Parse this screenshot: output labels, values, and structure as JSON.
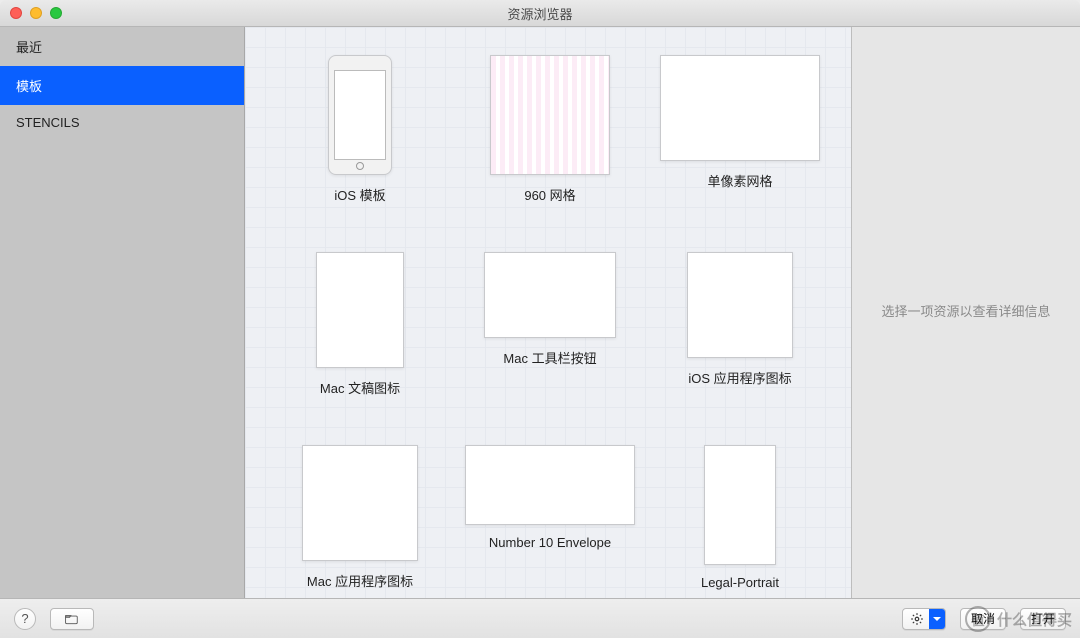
{
  "window": {
    "title": "资源浏览器"
  },
  "sidebar": {
    "items": [
      {
        "label": "最近",
        "selected": false
      },
      {
        "label": "模板",
        "selected": true
      },
      {
        "label": "STENCILS",
        "selected": false
      }
    ]
  },
  "templates": [
    {
      "id": "ios-template",
      "label": "iOS 模板",
      "thumb": "t-ios"
    },
    {
      "id": "grid-960",
      "label": "960 网格",
      "thumb": "t-960"
    },
    {
      "id": "pixel-grid",
      "label": "单像素网格",
      "thumb": "t-pixel"
    },
    {
      "id": "mac-doc-icon",
      "label": "Mac 文稿图标",
      "thumb": "t-doc"
    },
    {
      "id": "mac-toolbar-btn",
      "label": "Mac 工具栏按钮",
      "thumb": "t-tool"
    },
    {
      "id": "ios-app-icon",
      "label": "iOS 应用程序图标",
      "thumb": "t-iosapp"
    },
    {
      "id": "mac-app-icon",
      "label": "Mac 应用程序图标",
      "thumb": "t-macapp"
    },
    {
      "id": "num10-envelope",
      "label": "Number 10 Envelope",
      "thumb": "t-env"
    },
    {
      "id": "legal-portrait",
      "label": "Legal-Portrait",
      "thumb": "t-legal"
    }
  ],
  "rightpane": {
    "placeholder": "选择一项资源以查看详细信息"
  },
  "footer": {
    "help_tooltip": "?",
    "add_folder_icon": "folder-plus",
    "gear_icon": "gear",
    "cancel_label": "取消",
    "open_label": "打开"
  },
  "watermark": {
    "logo_text": "值",
    "text": "什么值得买"
  }
}
